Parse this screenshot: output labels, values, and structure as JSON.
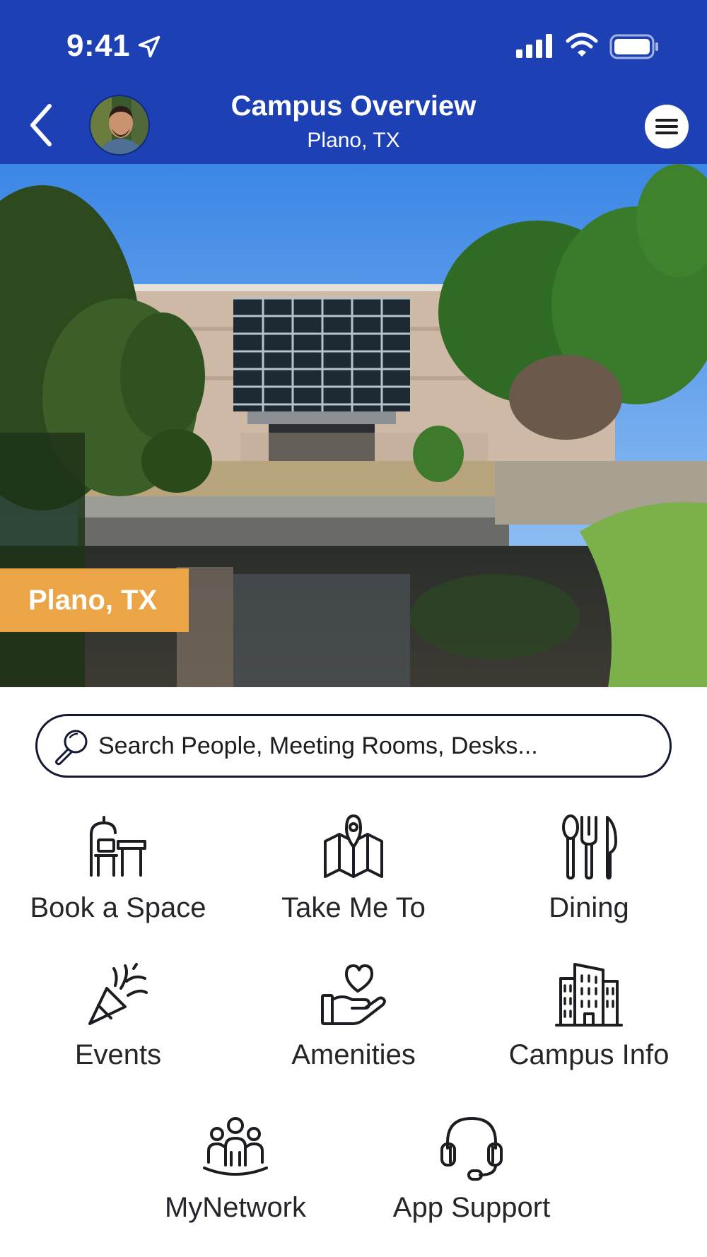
{
  "status_bar": {
    "time": "9:41",
    "icons": [
      "location-arrow-icon",
      "cellular-signal-icon",
      "wifi-icon",
      "battery-icon"
    ]
  },
  "header": {
    "title": "Campus Overview",
    "subtitle": "Plano, TX",
    "back_icon": "chevron-left-icon",
    "menu_icon": "hamburger-menu-icon",
    "background_color": "#1d41b4"
  },
  "hero": {
    "location_tag": "Plano, TX",
    "tag_color": "#eba546"
  },
  "search": {
    "placeholder": "Search People, Meeting Rooms, Desks..."
  },
  "tiles": [
    {
      "label": "Book a Space",
      "icon": "desk-chair-icon"
    },
    {
      "label": "Take Me To",
      "icon": "map-pin-icon"
    },
    {
      "label": "Dining",
      "icon": "utensils-icon"
    },
    {
      "label": "Events",
      "icon": "party-popper-icon"
    },
    {
      "label": "Amenities",
      "icon": "heart-hand-icon"
    },
    {
      "label": "Campus Info",
      "icon": "building-icon"
    },
    {
      "label": "MyNetwork",
      "icon": "people-group-icon"
    },
    {
      "label": "App Support",
      "icon": "headset-icon"
    }
  ]
}
